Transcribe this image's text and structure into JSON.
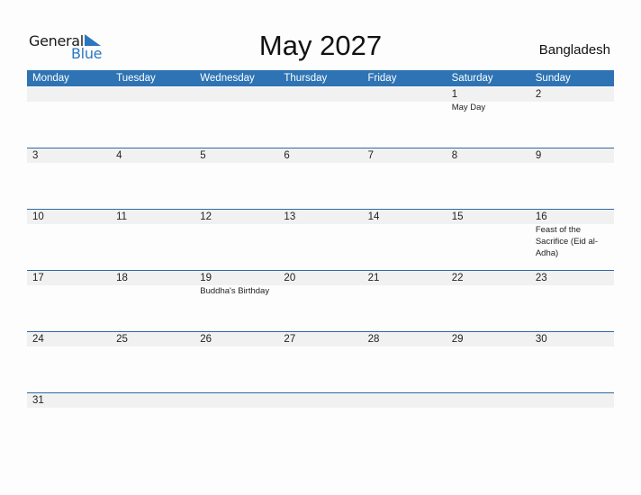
{
  "logo": {
    "word1": "General",
    "word2": "Blue"
  },
  "title": "May 2027",
  "country": "Bangladesh",
  "colors": {
    "header": "#2e73b3",
    "band": "#f1f1f1",
    "logo_blue": "#2a77c0"
  },
  "weekdays": [
    "Monday",
    "Tuesday",
    "Wednesday",
    "Thursday",
    "Friday",
    "Saturday",
    "Sunday"
  ],
  "weeks": [
    [
      {
        "d": ""
      },
      {
        "d": ""
      },
      {
        "d": ""
      },
      {
        "d": ""
      },
      {
        "d": ""
      },
      {
        "d": "1",
        "ev": "May Day"
      },
      {
        "d": "2"
      }
    ],
    [
      {
        "d": "3"
      },
      {
        "d": "4"
      },
      {
        "d": "5"
      },
      {
        "d": "6"
      },
      {
        "d": "7"
      },
      {
        "d": "8"
      },
      {
        "d": "9"
      }
    ],
    [
      {
        "d": "10"
      },
      {
        "d": "11"
      },
      {
        "d": "12"
      },
      {
        "d": "13"
      },
      {
        "d": "14"
      },
      {
        "d": "15"
      },
      {
        "d": "16",
        "ev": "Feast of the Sacrifice (Eid al-Adha)"
      }
    ],
    [
      {
        "d": "17"
      },
      {
        "d": "18"
      },
      {
        "d": "19",
        "ev": "Buddha's Birthday"
      },
      {
        "d": "20"
      },
      {
        "d": "21"
      },
      {
        "d": "22"
      },
      {
        "d": "23"
      }
    ],
    [
      {
        "d": "24"
      },
      {
        "d": "25"
      },
      {
        "d": "26"
      },
      {
        "d": "27"
      },
      {
        "d": "28"
      },
      {
        "d": "29"
      },
      {
        "d": "30"
      }
    ],
    [
      {
        "d": "31"
      }
    ]
  ]
}
